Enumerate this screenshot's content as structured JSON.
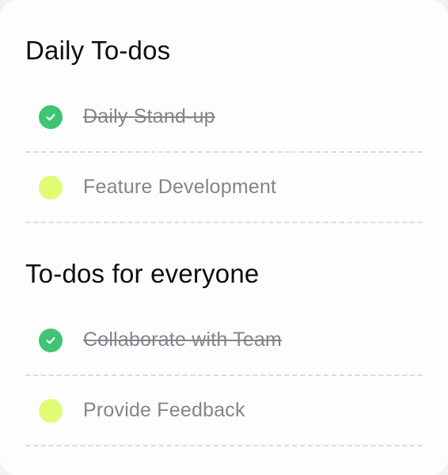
{
  "sections": [
    {
      "title": "Daily To-dos",
      "items": [
        {
          "label": "Daily Stand-up",
          "done": true
        },
        {
          "label": "Feature Development",
          "done": false
        }
      ]
    },
    {
      "title": "To-dos for everyone",
      "items": [
        {
          "label": "Collaborate with Team",
          "done": true
        },
        {
          "label": "Provide Feedback",
          "done": false
        }
      ]
    }
  ],
  "colors": {
    "done": "#3ec473",
    "pending": "#e0fb74",
    "title": "#0d0d12",
    "label": "#84848c"
  },
  "icons": {
    "done": "check-circle-icon",
    "pending": "empty-circle-icon"
  }
}
